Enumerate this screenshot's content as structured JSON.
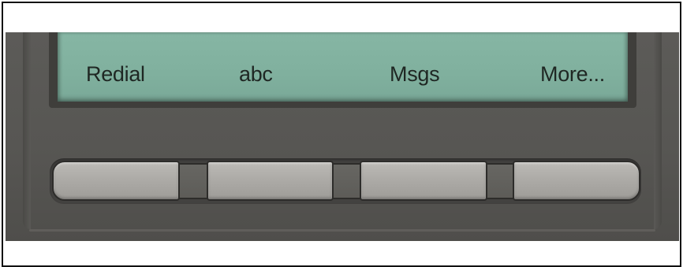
{
  "softkeys": {
    "labels": [
      "Redial",
      "abc",
      "Msgs",
      "More..."
    ]
  },
  "colors": {
    "lcd": "#80b09e",
    "housing": "#575653",
    "button": "#adaba7"
  }
}
